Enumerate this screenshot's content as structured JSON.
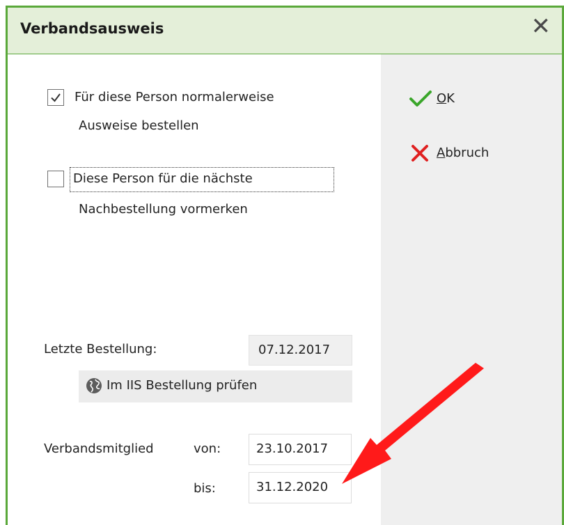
{
  "window": {
    "title": "Verbandsausweis",
    "close_glyph": "✕"
  },
  "options": {
    "normal_order": {
      "line1": "Für diese Person normalerweise",
      "line2": "Ausweise bestellen",
      "checked": true
    },
    "next_order": {
      "line1": "Diese Person für die nächste",
      "line2": "Nachbestellung vormerken",
      "checked": false
    }
  },
  "last_order": {
    "label": "Letzte Bestellung:",
    "value": "07.12.2017"
  },
  "iis_button": {
    "label": "Im IIS Bestellung prüfen",
    "icon": "globe-icon"
  },
  "membership": {
    "label": "Verbandsmitglied",
    "from_label": "von:",
    "from_value": "23.10.2017",
    "to_label": "bis:",
    "to_value": "31.12.2020"
  },
  "actions": {
    "ok": {
      "mnemonic": "O",
      "rest": "K",
      "icon": "check-icon",
      "color": "#3aa62a"
    },
    "cancel": {
      "mnemonic": "A",
      "rest": "bbruch",
      "icon": "cross-icon",
      "color": "#e02020"
    }
  },
  "annotation": {
    "icon": "red-arrow",
    "color": "#ff1a1a"
  }
}
